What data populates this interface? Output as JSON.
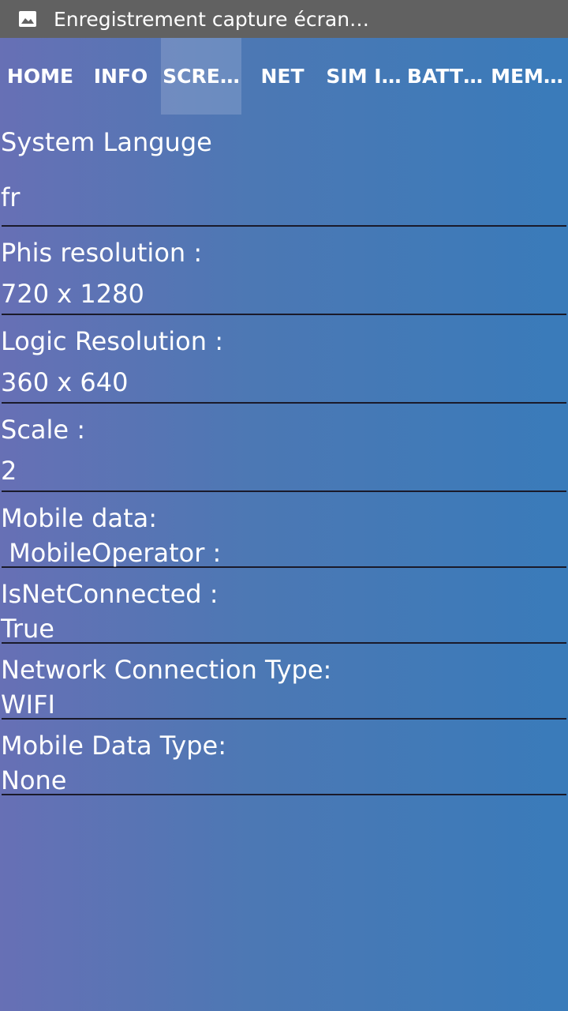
{
  "status_bar": {
    "icon": "image-icon",
    "text": "Enregistrement capture écran…"
  },
  "tabs": [
    {
      "label": "HOME",
      "active": false
    },
    {
      "label": "INFO",
      "active": false
    },
    {
      "label": "SCRE…",
      "active": true
    },
    {
      "label": "NET",
      "active": false
    },
    {
      "label": "SIM I…",
      "active": false
    },
    {
      "label": "BATT…",
      "active": false
    },
    {
      "label": "MEM…",
      "active": false
    }
  ],
  "rows": [
    {
      "label": "System Languge",
      "value": "fr"
    },
    {
      "label": "Phis resolution :",
      "value": "720 x 1280"
    },
    {
      "label": "Logic Resolution :",
      "value": "360 x 640"
    },
    {
      "label": "Scale  :",
      "value": "2"
    },
    {
      "label": "Mobile data:",
      "value": " MobileOperator :"
    },
    {
      "label": "IsNetConnected :",
      "value": "True"
    },
    {
      "label": "Network Connection Type:",
      "value": "WIFI"
    },
    {
      "label": "Mobile Data Type:",
      "value": "None"
    }
  ],
  "colors": {
    "status_bar": "#616161",
    "gradient_start": "#6770b5",
    "gradient_end": "#397bba",
    "divider": "#1a1a2a"
  }
}
